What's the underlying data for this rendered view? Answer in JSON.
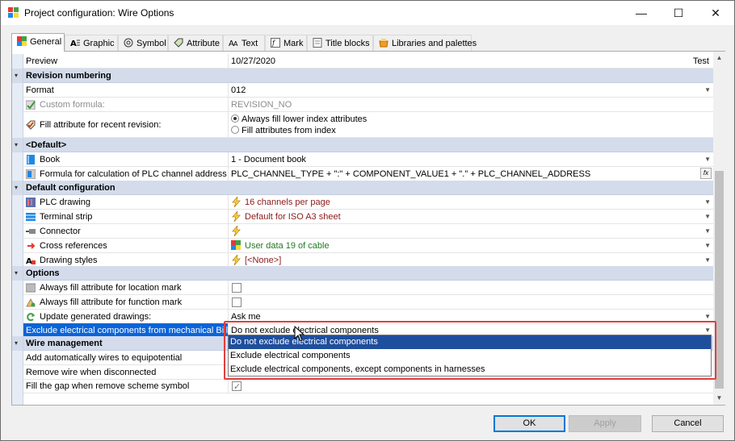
{
  "window": {
    "title": "Project configuration: Wire Options",
    "minimize": "—",
    "maximize": "☐",
    "close": "✕"
  },
  "tabs": [
    {
      "label": "General",
      "icon": "general-icon"
    },
    {
      "label": "Graphic",
      "icon": "graphic-icon"
    },
    {
      "label": "Symbol",
      "icon": "symbol-icon"
    },
    {
      "label": "Attribute",
      "icon": "attribute-icon"
    },
    {
      "label": "Text",
      "icon": "text-icon"
    },
    {
      "label": "Mark",
      "icon": "mark-icon"
    },
    {
      "label": "Title blocks",
      "icon": "title-blocks-icon"
    },
    {
      "label": "Libraries and palettes",
      "icon": "libraries-icon"
    }
  ],
  "grid": {
    "preview": {
      "name": "Preview",
      "value": "10/27/2020",
      "extra": "Test"
    },
    "revision": {
      "header": "Revision numbering",
      "format_name": "Format",
      "format_value": "012",
      "custom_name": "Custom formula:",
      "custom_value": "REVISION_NO",
      "fill_name": "Fill attribute for recent revision:",
      "radio1": "Always fill lower index attributes",
      "radio2": "Fill attributes from index"
    },
    "default": {
      "header": "<Default>",
      "book_name": "Book",
      "book_value": "1 - Document book",
      "plc_formula_name": "Formula for calculation of PLC channel address",
      "plc_formula_value": "PLC_CHANNEL_TYPE + \":\" + COMPONENT_VALUE1 + \".\" + PLC_CHANNEL_ADDRESS",
      "fx": "fx"
    },
    "default_config": {
      "header": "Default configuration",
      "plc_name": "PLC drawing",
      "plc_value": "16 channels per page",
      "terminal_name": "Terminal strip",
      "terminal_value": "Default for ISO A3 sheet",
      "connector_name": "Connector",
      "connector_value": "",
      "xref_name": "Cross references",
      "xref_value": "User data 19 of cable",
      "styles_name": "Drawing styles",
      "styles_value": "[<None>]"
    },
    "options": {
      "header": "Options",
      "location_name": "Always fill attribute for location mark",
      "function_name": "Always fill attribute for function mark",
      "update_name": "Update generated drawings:",
      "update_value": "Ask me",
      "exclude_name": "Exclude electrical components from mechanical Bill",
      "exclude_value": "Do not exclude electrical components"
    },
    "wire": {
      "header": "Wire management",
      "add_name": "Add automatically wires to equipotential",
      "remove_name": "Remove wire when disconnected",
      "fill_gap_name": "Fill the gap when remove scheme symbol"
    }
  },
  "dropdown": {
    "options": [
      "Do not exclude electrical components",
      "Exclude electrical components",
      "Exclude electrical components, except components in harnesses"
    ],
    "highlighted_index": 0
  },
  "buttons": {
    "ok": "OK",
    "apply": "Apply",
    "cancel": "Cancel"
  },
  "colors": {
    "category_bg": "#d4dceb",
    "selection": "#0a64d8",
    "highlight_red_border": "#e04040"
  }
}
